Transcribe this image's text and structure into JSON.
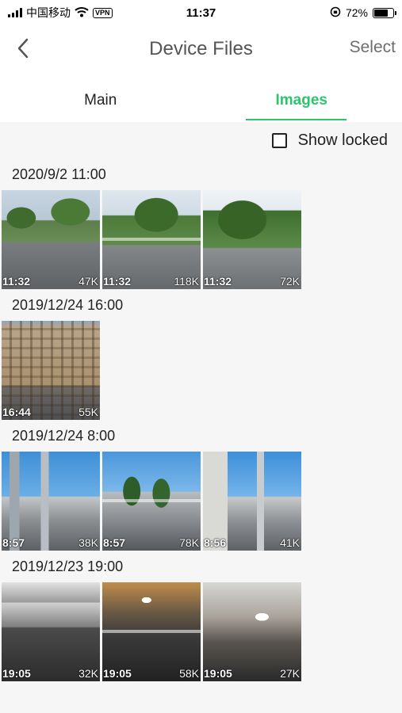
{
  "status_bar": {
    "carrier": "中国移动",
    "vpn": "VPN",
    "time": "11:37",
    "battery": "72%",
    "battery_level": 0.72
  },
  "nav": {
    "title": "Device Files",
    "select_label": "Select",
    "back_icon": "chevron-left-icon"
  },
  "tabs": [
    {
      "label": "Main",
      "active": false
    },
    {
      "label": "Images",
      "active": true
    }
  ],
  "accent_color": "#2ec46d",
  "filter": {
    "show_locked_label": "Show locked",
    "checked": false
  },
  "groups": [
    {
      "header": "2020/9/2 11:00",
      "items": [
        {
          "time": "11:32",
          "size": "47K",
          "scene": "scene-street"
        },
        {
          "time": "11:32",
          "size": "118K",
          "scene": "scene-street2"
        },
        {
          "time": "11:32",
          "size": "72K",
          "scene": "scene-street3"
        }
      ]
    },
    {
      "header": "2019/12/24 16:00",
      "items": [
        {
          "time": "16:44",
          "size": "55K",
          "scene": "scene-building"
        }
      ]
    },
    {
      "header": "2019/12/24 8:00",
      "items": [
        {
          "time": "8:57",
          "size": "38K",
          "scene": "scene-city"
        },
        {
          "time": "8:57",
          "size": "78K",
          "scene": "scene-city2"
        },
        {
          "time": "8:56",
          "size": "41K",
          "scene": "scene-city3"
        }
      ]
    },
    {
      "header": "2019/12/23 19:00",
      "items": [
        {
          "time": "19:05",
          "size": "32K",
          "scene": "scene-garage"
        },
        {
          "time": "19:05",
          "size": "58K",
          "scene": "scene-garage2"
        },
        {
          "time": "19:05",
          "size": "27K",
          "scene": "scene-garage3"
        }
      ]
    }
  ]
}
